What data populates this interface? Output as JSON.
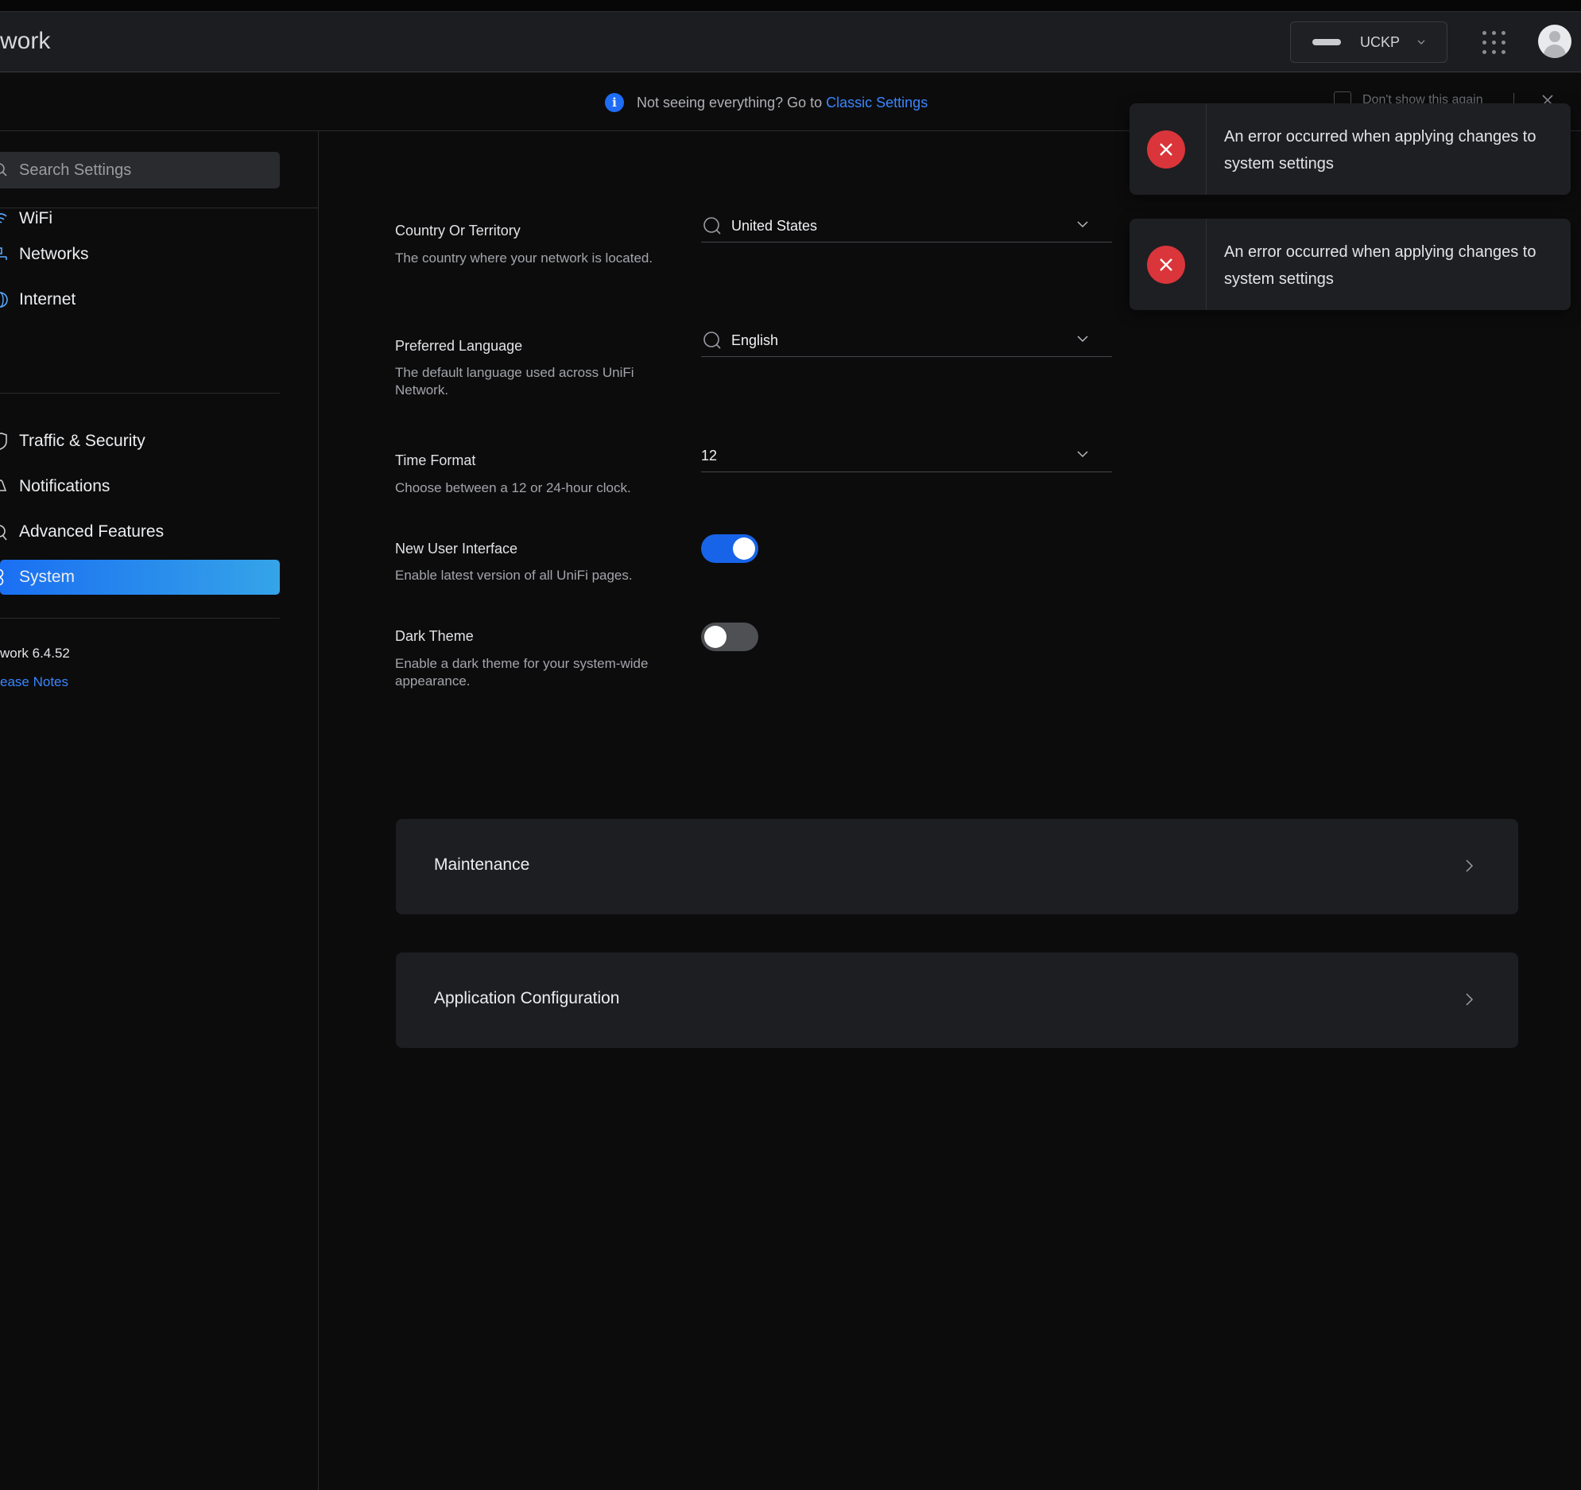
{
  "header": {
    "app_title": "work",
    "device": {
      "name": "UCKP"
    }
  },
  "infobar": {
    "message": "Not seeing everything? Go to",
    "link_label": "Classic Settings",
    "dont_show_label": "Don't show this again"
  },
  "sidebar": {
    "search_placeholder": "Search Settings",
    "items": [
      {
        "label": "WiFi",
        "icon": "wifi-icon"
      },
      {
        "label": "Networks",
        "icon": "networks-icon"
      },
      {
        "label": "Internet",
        "icon": "globe-icon"
      },
      {
        "label": "Traffic & Security",
        "icon": "shield-icon"
      },
      {
        "label": "Notifications",
        "icon": "bell-icon"
      },
      {
        "label": "Advanced Features",
        "icon": "advanced-icon"
      },
      {
        "label": "System",
        "icon": "system-icon",
        "active": true
      }
    ],
    "version": "work 6.4.52",
    "release_notes_label": "ease Notes"
  },
  "settings": {
    "country": {
      "title": "Country Or Territory",
      "description": "The country where your network is located.",
      "value": "United States"
    },
    "language": {
      "title": "Preferred Language",
      "description": "The default language used across UniFi Network.",
      "value": "English"
    },
    "time_format": {
      "title": "Time Format",
      "description": "Choose between a 12 or 24-hour clock.",
      "value": "12"
    },
    "new_ui": {
      "title": "New User Interface",
      "description": "Enable latest version of all UniFi pages.",
      "enabled": true
    },
    "dark_theme": {
      "title": "Dark Theme",
      "description": "Enable a dark theme for your system-wide appearance.",
      "enabled": false
    }
  },
  "panels": {
    "maintenance": "Maintenance",
    "app_config": "Application Configuration"
  },
  "toasts": [
    {
      "message": "An error occurred when applying changes to system settings"
    },
    {
      "message": "An error occurred when applying changes to system settings"
    }
  ],
  "colors": {
    "accent": "#1764e8",
    "link": "#3a86ff",
    "error": "#d9353a",
    "background": "#0c0c0d",
    "panel": "#1d1e21"
  }
}
